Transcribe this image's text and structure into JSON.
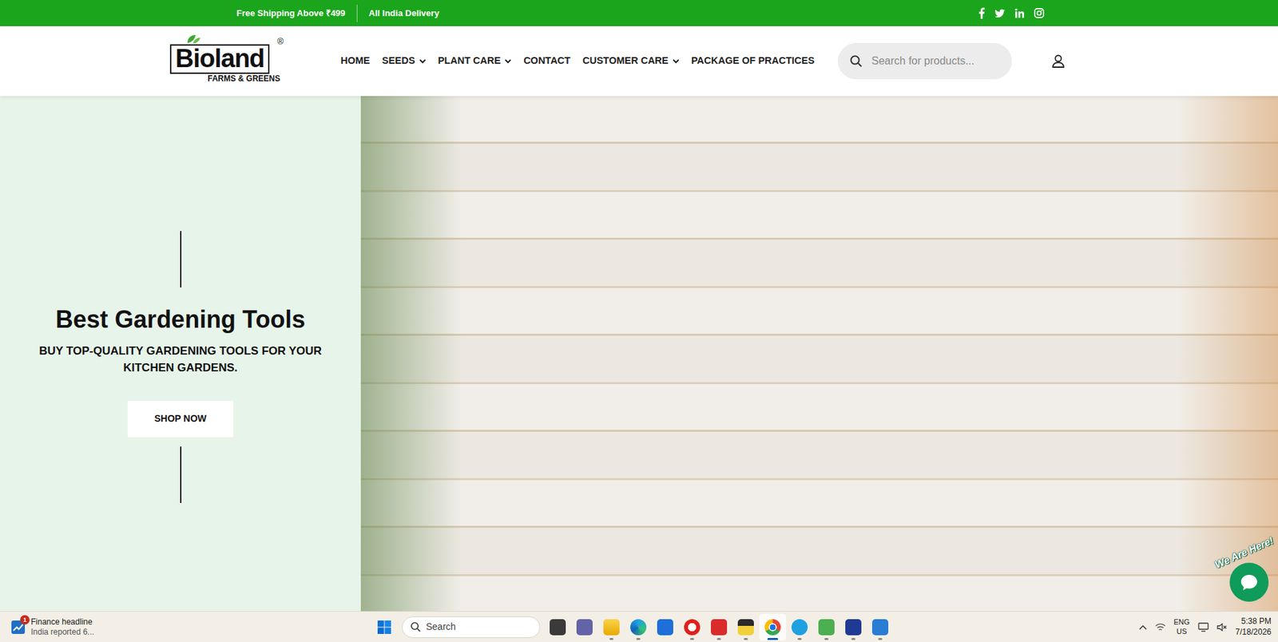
{
  "topbar": {
    "items": [
      "Free Shipping Above ₹499",
      "All India Delivery"
    ]
  },
  "logo": {
    "name": "Bioland",
    "tagline": "FARMS & GREENS",
    "mark": "®"
  },
  "nav": [
    {
      "label": "HOME",
      "dropdown": false
    },
    {
      "label": "SEEDS",
      "dropdown": true
    },
    {
      "label": "PLANT CARE",
      "dropdown": true
    },
    {
      "label": "CONTACT",
      "dropdown": false
    },
    {
      "label": "CUSTOMER CARE",
      "dropdown": true
    },
    {
      "label": "PACKAGE OF PRACTICES",
      "dropdown": false
    }
  ],
  "search": {
    "placeholder": "Search for products..."
  },
  "hero": {
    "title": "Best Gardening Tools",
    "subtitle": "BUY TOP-QUALITY GARDENING TOOLS FOR YOUR KITCHEN GARDENS.",
    "button": "SHOP NOW"
  },
  "chat": {
    "label": "We Are Here!"
  },
  "taskbar": {
    "widget": {
      "title": "Finance headline",
      "text": "India reported 6...",
      "badge": "1"
    },
    "search": {
      "placeholder": "Search"
    },
    "apps": [
      {
        "running": false,
        "selected": false
      },
      {
        "running": false,
        "selected": false
      },
      {
        "running": true,
        "selected": false
      },
      {
        "running": true,
        "selected": false
      },
      {
        "running": false,
        "selected": false
      },
      {
        "running": true,
        "selected": false
      },
      {
        "running": true,
        "selected": false
      },
      {
        "running": true,
        "selected": false
      },
      {
        "running": true,
        "selected": true
      },
      {
        "running": true,
        "selected": false
      },
      {
        "running": true,
        "selected": false
      },
      {
        "running": true,
        "selected": false
      },
      {
        "running": true,
        "selected": false
      }
    ],
    "tray": {
      "language": "ENG",
      "region": "US",
      "time": "5:38 PM",
      "date": "7/18/2026"
    }
  }
}
